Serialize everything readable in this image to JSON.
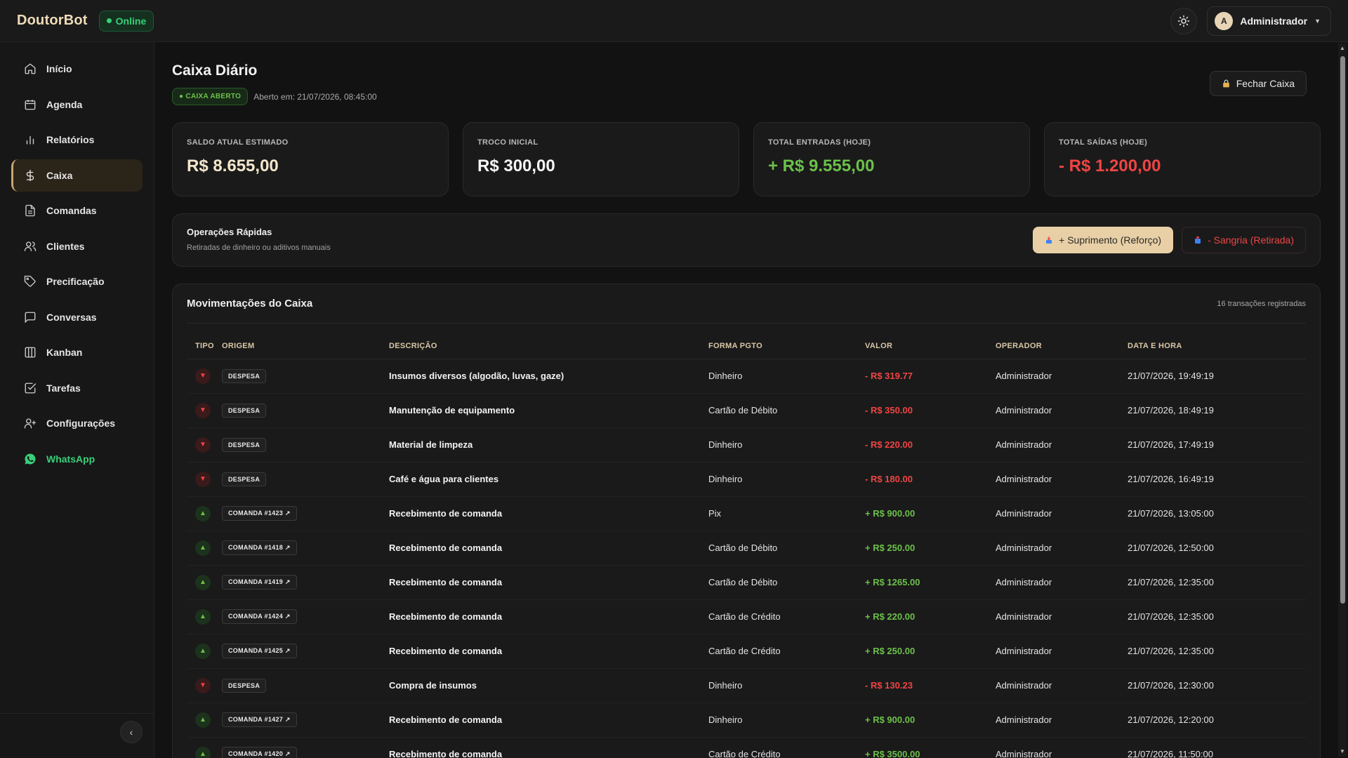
{
  "topbar": {
    "brand": "DoutorBot",
    "status": "Online",
    "user_initial": "A",
    "user_name": "Administrador"
  },
  "sidebar": {
    "items": [
      {
        "label": "Início",
        "icon": "home-icon"
      },
      {
        "label": "Agenda",
        "icon": "calendar-icon"
      },
      {
        "label": "Relatórios",
        "icon": "bar-chart-icon"
      },
      {
        "label": "Caixa",
        "icon": "dollar-icon"
      },
      {
        "label": "Comandas",
        "icon": "document-icon"
      },
      {
        "label": "Clientes",
        "icon": "users-icon"
      },
      {
        "label": "Precificação",
        "icon": "tag-icon"
      },
      {
        "label": "Conversas",
        "icon": "message-icon"
      },
      {
        "label": "Kanban",
        "icon": "kanban-icon"
      },
      {
        "label": "Tarefas",
        "icon": "checkbox-icon"
      },
      {
        "label": "Configurações",
        "icon": "user-plus-icon"
      },
      {
        "label": "WhatsApp",
        "icon": "whatsapp-icon"
      }
    ],
    "active": "Caixa"
  },
  "page": {
    "title": "Caixa Diário",
    "badge": "● CAIXA ABERTO",
    "opened_at": "Aberto em: 21/07/2026, 08:45:00",
    "close_button": "Fechar Caixa"
  },
  "cards": [
    {
      "label": "SALDO ATUAL ESTIMADO",
      "value": "R$ 8.655,00"
    },
    {
      "label": "TROCO INICIAL",
      "value": "R$ 300,00"
    },
    {
      "label": "TOTAL ENTRADAS (HOJE)",
      "value": "+ R$ 9.555,00"
    },
    {
      "label": "TOTAL SAÍDAS (HOJE)",
      "value": "- R$ 1.200,00"
    }
  ],
  "quick_ops": {
    "title": "Operações Rápidas",
    "subtitle": "Retiradas de dinheiro ou aditivos manuais",
    "supply_button": "+ Suprimento (Reforço)",
    "withdraw_button": "- Sangria (Retirada)"
  },
  "movements": {
    "title": "Movimentações do Caixa",
    "count": "16 transações registradas",
    "columns": [
      "TIPO",
      "ORIGEM",
      "DESCRIÇÃO",
      "FORMA PGTO",
      "VALOR",
      "OPERADOR",
      "DATA E HORA"
    ],
    "rows": [
      {
        "type": "out",
        "origin": "DESPESA",
        "desc": "Insumos diversos (algodão, luvas, gaze)",
        "payment": "Dinheiro",
        "value": "- R$ 319.77",
        "operator": "Administrador",
        "datetime": "21/07/2026, 19:49:19"
      },
      {
        "type": "out",
        "origin": "DESPESA",
        "desc": "Manutenção de equipamento",
        "payment": "Cartão de Débito",
        "value": "- R$ 350.00",
        "operator": "Administrador",
        "datetime": "21/07/2026, 18:49:19"
      },
      {
        "type": "out",
        "origin": "DESPESA",
        "desc": "Material de limpeza",
        "payment": "Dinheiro",
        "value": "- R$ 220.00",
        "operator": "Administrador",
        "datetime": "21/07/2026, 17:49:19"
      },
      {
        "type": "out",
        "origin": "DESPESA",
        "desc": "Café e água para clientes",
        "payment": "Dinheiro",
        "value": "- R$ 180.00",
        "operator": "Administrador",
        "datetime": "21/07/2026, 16:49:19"
      },
      {
        "type": "in",
        "origin": "COMANDA #1423 ↗",
        "desc": "Recebimento de comanda",
        "payment": "Pix",
        "value": "+ R$ 900.00",
        "operator": "Administrador",
        "datetime": "21/07/2026, 13:05:00"
      },
      {
        "type": "in",
        "origin": "COMANDA #1418 ↗",
        "desc": "Recebimento de comanda",
        "payment": "Cartão de Débito",
        "value": "+ R$ 250.00",
        "operator": "Administrador",
        "datetime": "21/07/2026, 12:50:00"
      },
      {
        "type": "in",
        "origin": "COMANDA #1419 ↗",
        "desc": "Recebimento de comanda",
        "payment": "Cartão de Débito",
        "value": "+ R$ 1265.00",
        "operator": "Administrador",
        "datetime": "21/07/2026, 12:35:00"
      },
      {
        "type": "in",
        "origin": "COMANDA #1424 ↗",
        "desc": "Recebimento de comanda",
        "payment": "Cartão de Crédito",
        "value": "+ R$ 220.00",
        "operator": "Administrador",
        "datetime": "21/07/2026, 12:35:00"
      },
      {
        "type": "in",
        "origin": "COMANDA #1425 ↗",
        "desc": "Recebimento de comanda",
        "payment": "Cartão de Crédito",
        "value": "+ R$ 250.00",
        "operator": "Administrador",
        "datetime": "21/07/2026, 12:35:00"
      },
      {
        "type": "out",
        "origin": "DESPESA",
        "desc": "Compra de insumos",
        "payment": "Dinheiro",
        "value": "- R$ 130.23",
        "operator": "Administrador",
        "datetime": "21/07/2026, 12:30:00"
      },
      {
        "type": "in",
        "origin": "COMANDA #1427 ↗",
        "desc": "Recebimento de comanda",
        "payment": "Dinheiro",
        "value": "+ R$ 900.00",
        "operator": "Administrador",
        "datetime": "21/07/2026, 12:20:00"
      },
      {
        "type": "in",
        "origin": "COMANDA #1420 ↗",
        "desc": "Recebimento de comanda",
        "payment": "Cartão de Crédito",
        "value": "+ R$ 3500.00",
        "operator": "Administrador",
        "datetime": "21/07/2026, 11:50:00"
      }
    ]
  },
  "colors": {
    "accent": "#c9a670",
    "positive": "#6cc04a",
    "negative": "#ef4444",
    "online": "#38d07a"
  }
}
